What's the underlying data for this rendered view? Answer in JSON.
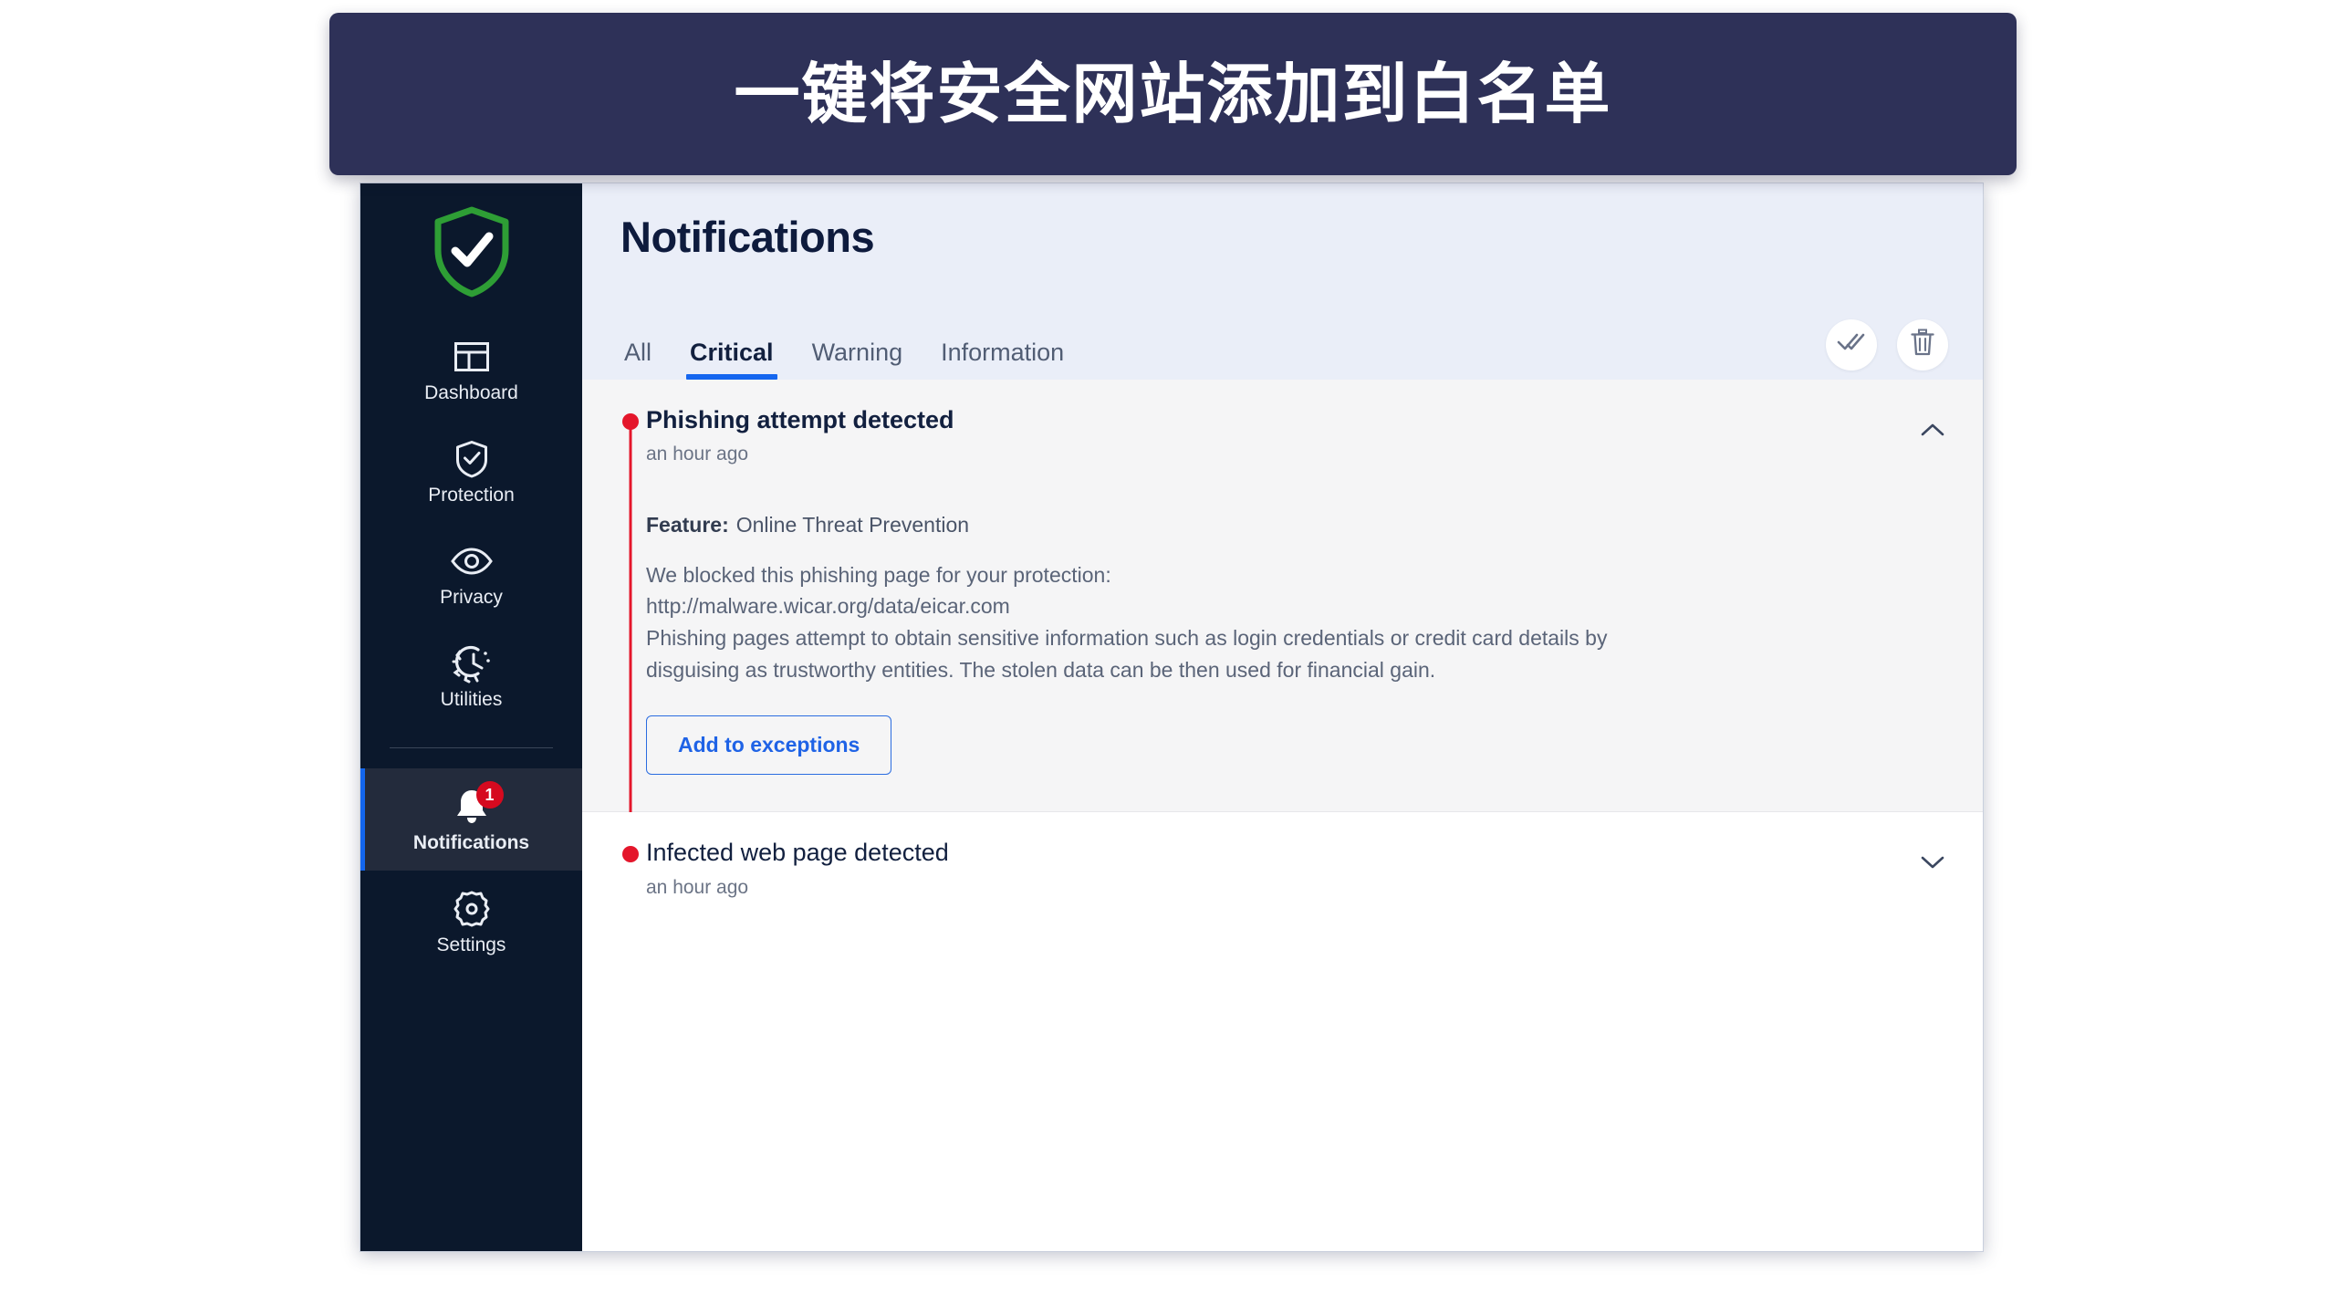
{
  "banner": {
    "text": "一键将安全网站添加到白名单",
    "background_color": "#2e3158"
  },
  "sidebar": {
    "logo_icon": "green-shield-check-logo",
    "items": [
      {
        "label": "Dashboard",
        "icon": "dashboard-layout-icon",
        "active": false
      },
      {
        "label": "Protection",
        "icon": "shield-check-icon",
        "active": false
      },
      {
        "label": "Privacy",
        "icon": "eye-icon",
        "active": false
      },
      {
        "label": "Utilities",
        "icon": "gear-clock-icon",
        "active": false
      },
      {
        "label": "Notifications",
        "icon": "bell-icon",
        "active": true,
        "badge": "1"
      },
      {
        "label": "Settings",
        "icon": "gear-icon",
        "active": false
      }
    ],
    "accent_color": "#1366ee",
    "badge_color": "#d60a1f",
    "background_color": "#0b182c"
  },
  "header": {
    "title": "Notifications",
    "tabs": [
      {
        "label": "All",
        "active": false
      },
      {
        "label": "Critical",
        "active": true
      },
      {
        "label": "Warning",
        "active": false
      },
      {
        "label": "Information",
        "active": false
      }
    ],
    "actions": [
      {
        "name": "mark-all-read",
        "icon": "double-check-icon"
      },
      {
        "name": "delete-all",
        "icon": "trash-icon"
      }
    ],
    "tab_accent_color": "#1566ef",
    "background_color": "#eaeef8"
  },
  "notifications": [
    {
      "title": "Phishing attempt detected",
      "time": "an hour ago",
      "severity": "critical",
      "severity_color": "#e4162b",
      "expanded": true,
      "chevron": "chevron-up-icon",
      "feature_label": "Feature:",
      "feature_value": "Online Threat Prevention",
      "description_lines": [
        "We blocked this phishing page for your protection:",
        "http://malware.wicar.org/data/eicar.com",
        "Phishing pages attempt to obtain sensitive information such as login credentials or credit card details by",
        "disguising as trustworthy entities. The stolen data can be then used for financial gain."
      ],
      "action_button": "Add to exceptions"
    },
    {
      "title": "Infected web page detected",
      "time": "an hour ago",
      "severity": "critical",
      "severity_color": "#e4162b",
      "expanded": false,
      "chevron": "chevron-down-icon"
    }
  ]
}
